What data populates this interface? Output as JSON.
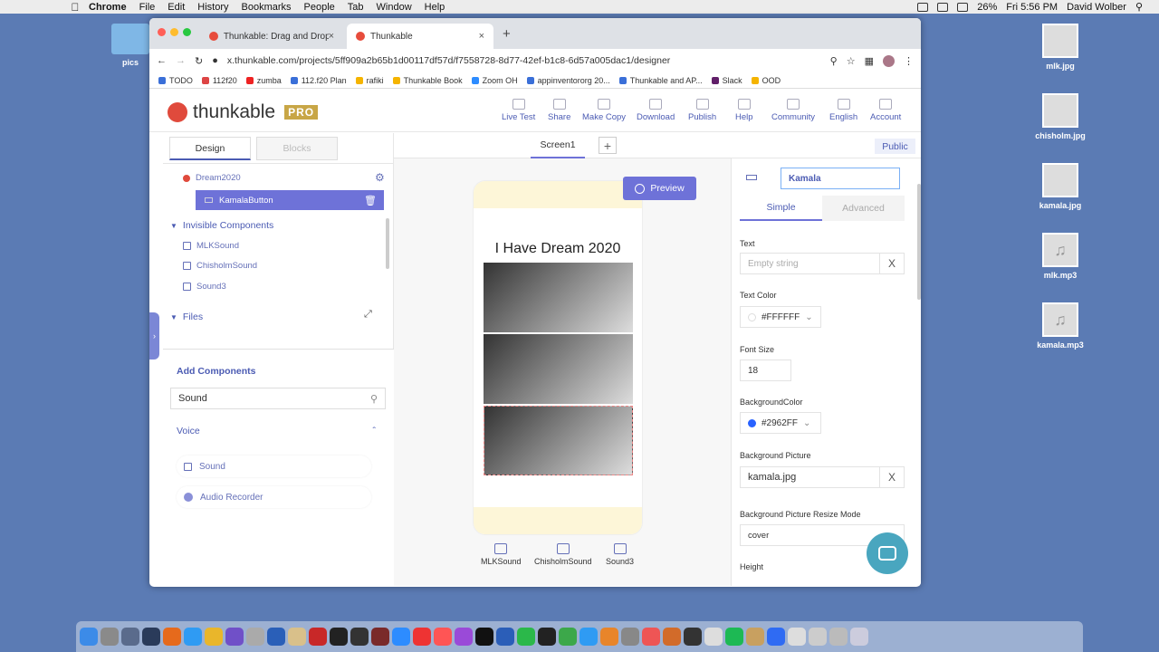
{
  "menubar": {
    "app": "Chrome",
    "items": [
      "File",
      "Edit",
      "History",
      "Bookmarks",
      "People",
      "Tab",
      "Window",
      "Help"
    ],
    "battery": "26%",
    "time": "Fri 5:56 PM",
    "user": "David Wolber"
  },
  "desktop": {
    "folder": "pics",
    "files": [
      "mlk.jpg",
      "chisholm.jpg",
      "kamala.jpg",
      "mlk.mp3",
      "kamala.mp3"
    ]
  },
  "browser": {
    "tabs": [
      {
        "label": "Thunkable: Drag and Drop App"
      },
      {
        "label": "Thunkable"
      }
    ],
    "url": "x.thunkable.com/projects/5ff909a2b65b1d00117df57d/f7558728-8d77-42ef-b1c8-6d57a005dac1/designer",
    "bookmarks": [
      "TODO",
      "112f20",
      "zumba",
      "112.f20 Plan",
      "rafiki",
      "Thunkable Book",
      "Zoom OH",
      "appinventororg 20...",
      "Thunkable and AP...",
      "Slack",
      "OOD"
    ]
  },
  "header": {
    "brand": "thunkable",
    "pro": "PRO",
    "nav": [
      "Live Test",
      "Share",
      "Make Copy",
      "Download",
      "Publish",
      "Help",
      "Community",
      "English",
      "Account"
    ]
  },
  "designer": {
    "tabs": {
      "design": "Design",
      "blocks": "Blocks"
    },
    "screen": "Screen1",
    "add_symbol": "+",
    "public": "Public",
    "tree": {
      "root": "Dream2020",
      "selected": "KamalaButton",
      "invisible_header": "Invisible Components",
      "invisible": [
        "MLKSound",
        "ChisholmSound",
        "Sound3"
      ],
      "files": "Files"
    },
    "add_components": {
      "title": "Add Components",
      "search": "Sound",
      "category": "Voice",
      "items": [
        "Sound",
        "Audio Recorder"
      ]
    }
  },
  "canvas": {
    "preview": "Preview",
    "app_title": "I Have Dream 2020",
    "invisible": [
      "MLKSound",
      "ChisholmSound",
      "Sound3"
    ]
  },
  "properties": {
    "name": "Kamala",
    "tabs": {
      "simple": "Simple",
      "advanced": "Advanced"
    },
    "text_label": "Text",
    "text_placeholder": "Empty string",
    "text_color_label": "Text Color",
    "text_color": "#FFFFFF",
    "font_size_label": "Font Size",
    "font_size": "18",
    "bg_color_label": "BackgroundColor",
    "bg_color": "#2962FF",
    "bg_picture_label": "Background Picture",
    "bg_picture": "kamala.jpg",
    "resize_label": "Background Picture Resize Mode",
    "resize": "cover",
    "height_label": "Height",
    "clear": "X"
  },
  "colors": {
    "accent": "#6e72d8",
    "brand_red": "#e04a3c",
    "pro_gold": "#c8a646",
    "bg_swatch": "#2962FF"
  }
}
